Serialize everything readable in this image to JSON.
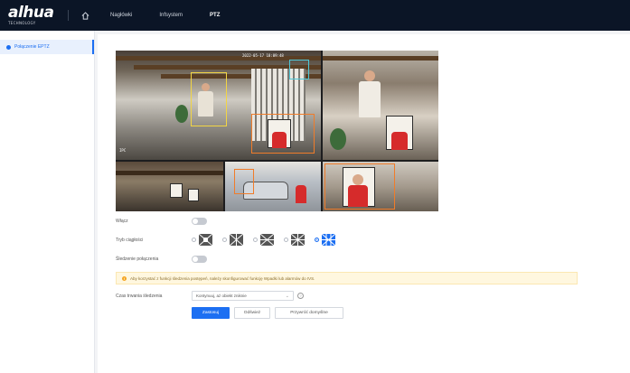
{
  "app": {
    "logo_text": "alhua",
    "logo_sub": "TECHNOLOGY"
  },
  "nav": {
    "items": [
      {
        "label": "Nagłówki",
        "active": false
      },
      {
        "label": "Infsystem",
        "active": false
      },
      {
        "label": "PTZ",
        "active": true
      }
    ],
    "home_icon": "home-icon"
  },
  "sidebar": {
    "items": [
      {
        "label": "Połączenie EPTZ",
        "active": true
      }
    ]
  },
  "video": {
    "timestamp": "2022-05-17 18:09:48",
    "channel_label": "IPC"
  },
  "form": {
    "enable_label": "Włącz",
    "enable_on": false,
    "mode_label": "Tryb ciągłości",
    "modes": [
      {
        "icon": "layout-1-icon",
        "selected": false
      },
      {
        "icon": "layout-2-icon",
        "selected": false
      },
      {
        "icon": "layout-3-icon",
        "selected": false
      },
      {
        "icon": "layout-4-icon",
        "selected": false
      },
      {
        "icon": "layout-5-icon",
        "selected": true
      }
    ],
    "track_label": "Śledzenie połączenia",
    "track_on": false,
    "alert_text": "Aby korzystać z funkcji śledzenia postępeń, należy skonfigurować funkcję Wpadki lub alarmów do IVS.",
    "duration_label": "Czas trwania śledzenia",
    "duration_value": "Kontynuuj, aż obiekt zniknie",
    "buttons": {
      "apply": "Zastosuj",
      "refresh": "Odśwież",
      "default": "Przywróć domyślne"
    }
  },
  "colors": {
    "accent": "#1c6ff2",
    "topbar": "#0b1526",
    "alert_bg": "#fff7df",
    "track_box": "#f07c2a"
  }
}
